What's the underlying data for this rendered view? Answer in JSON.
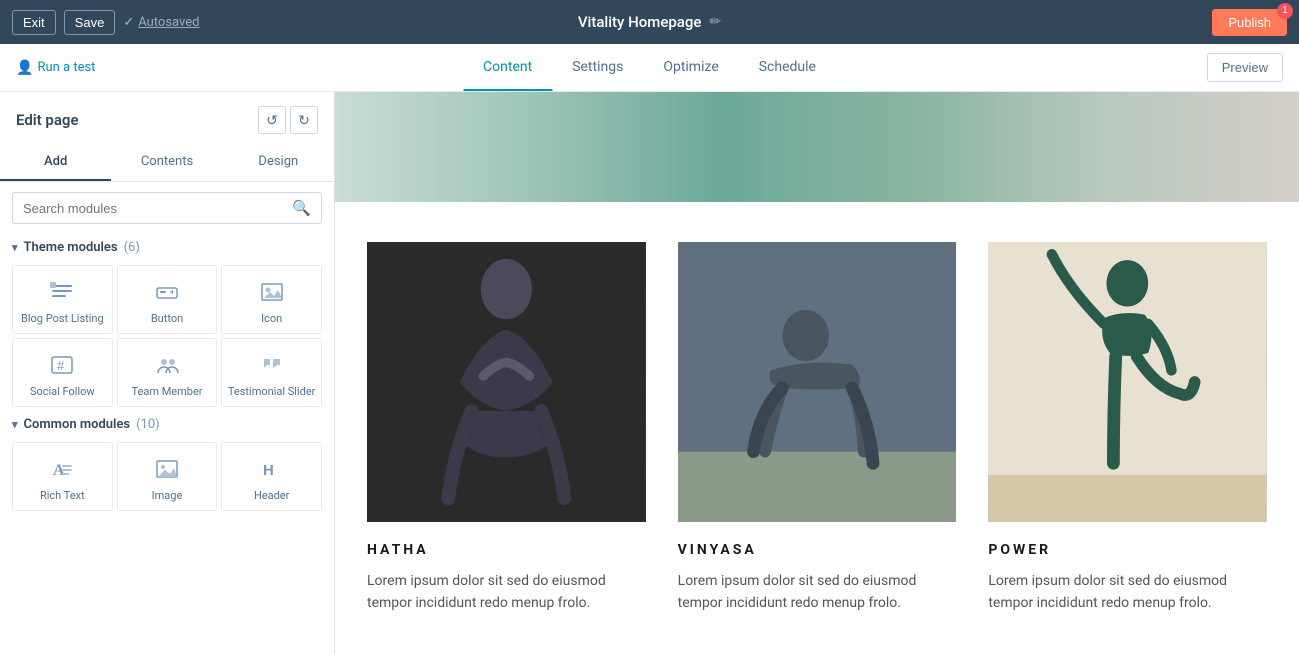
{
  "topbar": {
    "exit_label": "Exit",
    "save_label": "Save",
    "autosaved_label": "Autosaved",
    "page_title": "Vitality Homepage",
    "publish_label": "Publish",
    "publish_badge": "1"
  },
  "subnav": {
    "run_test_label": "Run a test",
    "tabs": [
      {
        "label": "Content",
        "active": true
      },
      {
        "label": "Settings",
        "active": false
      },
      {
        "label": "Optimize",
        "active": false
      },
      {
        "label": "Schedule",
        "active": false
      }
    ],
    "preview_label": "Preview"
  },
  "sidebar": {
    "edit_page_title": "Edit page",
    "undo_label": "↺",
    "redo_label": "↻",
    "tabs": [
      {
        "label": "Add",
        "active": true
      },
      {
        "label": "Contents",
        "active": false
      },
      {
        "label": "Design",
        "active": false
      }
    ],
    "search_placeholder": "Search modules",
    "theme_modules_label": "Theme modules",
    "theme_modules_count": "(6)",
    "theme_modules": [
      {
        "label": "Blog Post Listing",
        "icon": "list"
      },
      {
        "label": "Button",
        "icon": "button"
      },
      {
        "label": "Icon",
        "icon": "image"
      },
      {
        "label": "Social Follow",
        "icon": "hashtag"
      },
      {
        "label": "Team Member",
        "icon": "team"
      },
      {
        "label": "Testimonial Slider",
        "icon": "quote"
      }
    ],
    "common_modules_label": "Common modules",
    "common_modules_count": "(10)",
    "common_modules": [
      {
        "label": "Rich Text",
        "icon": "text"
      },
      {
        "label": "Image",
        "icon": "image"
      },
      {
        "label": "Header",
        "icon": "header"
      }
    ]
  },
  "canvas": {
    "yoga_cards": [
      {
        "title": "HATHA",
        "description": "Lorem ipsum dolor sit sed do eiusmod tempor incididunt redo menup frolo.",
        "img_class": "yoga-img-hatha"
      },
      {
        "title": "VINYASA",
        "description": "Lorem ipsum dolor sit sed do eiusmod tempor incididunt redo menup frolo.",
        "img_class": "yoga-img-vinyasa"
      },
      {
        "title": "POWER",
        "description": "Lorem ipsum dolor sit sed do eiusmod tempor incididunt redo menup frolo.",
        "img_class": "yoga-img-power"
      }
    ]
  }
}
